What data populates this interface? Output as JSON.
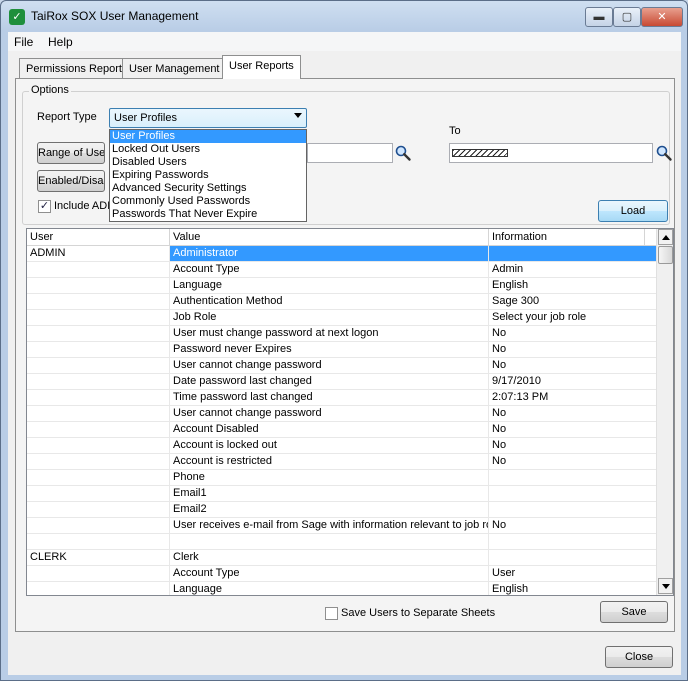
{
  "window": {
    "title": "TaiRox SOX User Management",
    "controls": {
      "minimize": "▬",
      "maximize": "▢",
      "close": "✕"
    }
  },
  "menu": {
    "file": "File",
    "help": "Help"
  },
  "tabs": [
    {
      "label": "Permissions Report",
      "active": false
    },
    {
      "label": "User Management",
      "active": false
    },
    {
      "label": "User Reports",
      "active": true
    }
  ],
  "options": {
    "legend": "Options",
    "report_type_label": "Report Type",
    "report_type_value": "User Profiles",
    "report_type_options": [
      "User Profiles",
      "Locked Out Users",
      "Disabled Users",
      "Expiring Passwords",
      "Advanced Security Settings",
      "Commonly Used Passwords",
      "Passwords That Never Expire"
    ],
    "range_button_label": "Range of Users",
    "enabled_button_label": "Enabled/Disabled",
    "to_label": "To",
    "include_checkbox_label": "Include ADMIN",
    "include_checked": true,
    "load_button_label": "Load"
  },
  "grid": {
    "columns": [
      "User",
      "Value",
      "Information"
    ],
    "rows": [
      [
        "ADMIN",
        "Administrator",
        ""
      ],
      [
        "",
        "Account Type",
        "Admin"
      ],
      [
        "",
        "Language",
        "English"
      ],
      [
        "",
        "Authentication Method",
        "Sage 300"
      ],
      [
        "",
        "Job Role",
        "Select your job role"
      ],
      [
        "",
        "User must change password at next logon",
        "No"
      ],
      [
        "",
        "Password never Expires",
        "No"
      ],
      [
        "",
        "User cannot change password",
        "No"
      ],
      [
        "",
        "Date password last changed",
        "9/17/2010"
      ],
      [
        "",
        "Time password last changed",
        "2:07:13 PM"
      ],
      [
        "",
        "User cannot change password",
        "No"
      ],
      [
        "",
        "Account Disabled",
        "No"
      ],
      [
        "",
        "Account is locked out",
        "No"
      ],
      [
        "",
        "Account is restricted",
        "No"
      ],
      [
        "",
        "Phone",
        ""
      ],
      [
        "",
        "Email1",
        ""
      ],
      [
        "",
        "Email2",
        ""
      ],
      [
        "",
        "User receives e-mail from Sage with information relevant to job role",
        "No"
      ],
      [
        "",
        "",
        ""
      ],
      [
        "CLERK",
        "Clerk",
        ""
      ],
      [
        "",
        "Account Type",
        "User"
      ],
      [
        "",
        "Language",
        "English"
      ]
    ],
    "selected_row": 0
  },
  "footer": {
    "save_separate_label": "Save Users to Separate Sheets",
    "save_separate_checked": false,
    "save_button_label": "Save",
    "close_button_label": "Close"
  },
  "colors": {
    "selection": "#3399ff",
    "window_frame": "#b9cde6"
  }
}
